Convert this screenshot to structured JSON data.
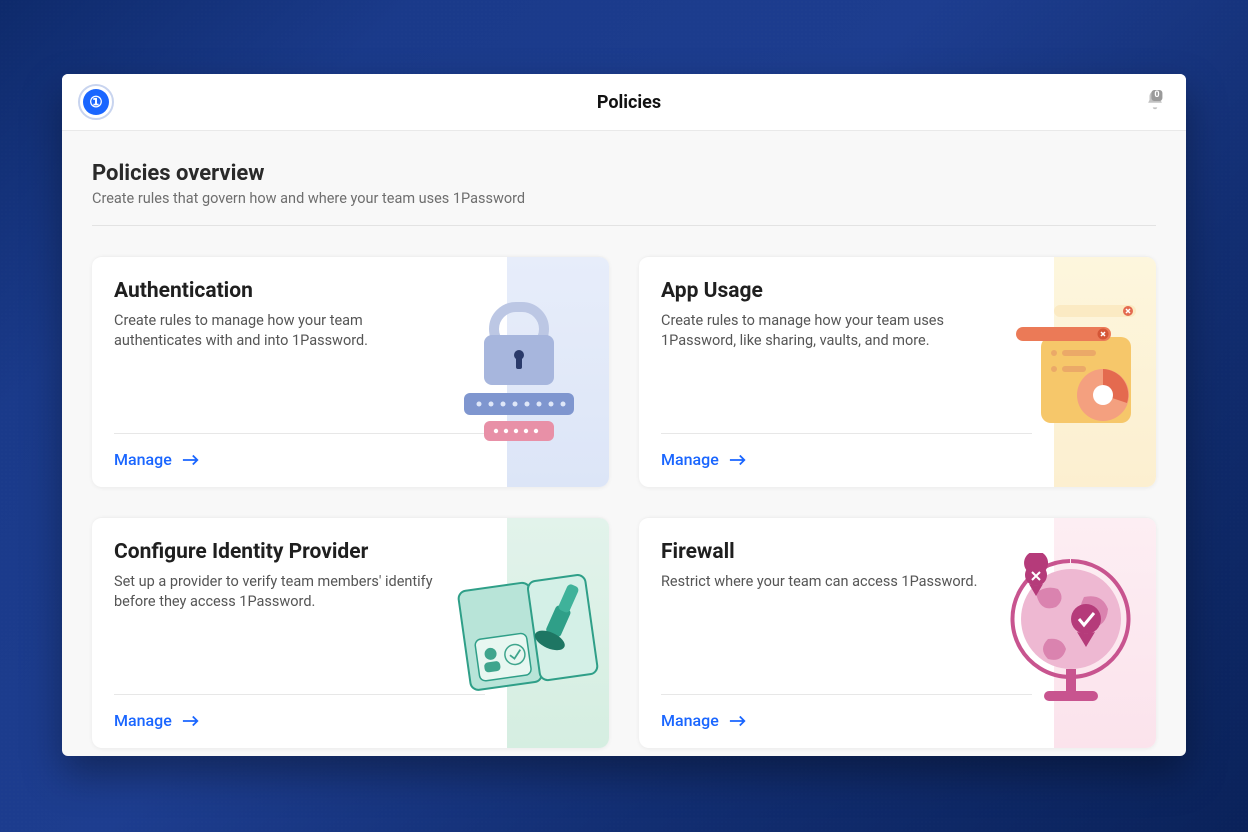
{
  "header": {
    "title": "Policies",
    "notification_count": "0"
  },
  "overview": {
    "title": "Policies overview",
    "subtitle": "Create rules that govern how and where your team uses 1Password"
  },
  "cards": {
    "authentication": {
      "title": "Authentication",
      "desc": "Create rules to manage how your team authenticates with and into 1Password.",
      "manage": "Manage"
    },
    "app_usage": {
      "title": "App Usage",
      "desc": "Create rules to manage how your team uses 1Password, like sharing, vaults, and more.",
      "manage": "Manage"
    },
    "idp": {
      "title": "Configure Identity Provider",
      "desc": "Set up a provider to verify team members' identify before they access 1Password.",
      "manage": "Manage"
    },
    "firewall": {
      "title": "Firewall",
      "desc": "Restrict where your team can access 1Password.",
      "manage": "Manage"
    }
  }
}
